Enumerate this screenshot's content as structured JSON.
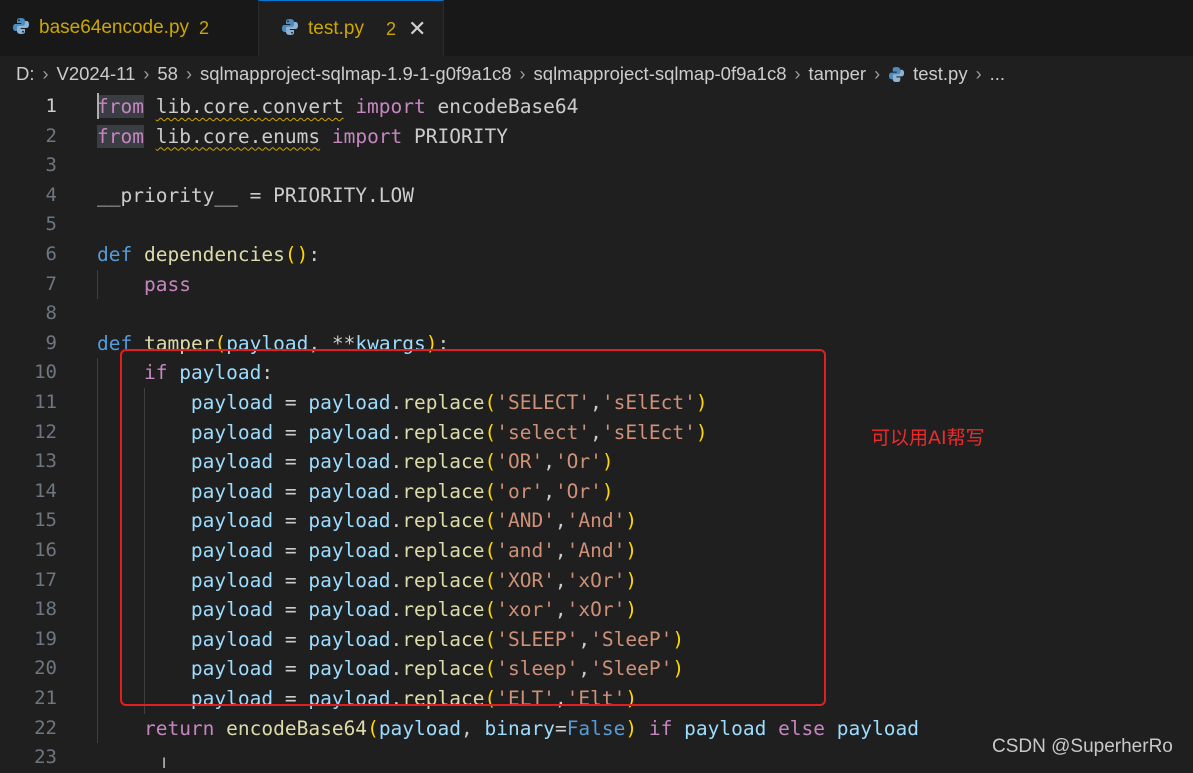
{
  "tabs": [
    {
      "name": "base64encode.py",
      "problems": "2",
      "icon": "python-icon"
    },
    {
      "name": "test.py",
      "problems": "2",
      "icon": "python-icon",
      "close": "✕"
    }
  ],
  "breadcrumb": {
    "items": [
      "D:",
      "V2024-11",
      "58",
      "sqlmapproject-sqlmap-1.9-1-g0f9a1c8",
      "sqlmapproject-sqlmap-0f9a1c8",
      "tamper"
    ],
    "file": "test.py",
    "more": "..."
  },
  "editor": {
    "active_line": 1,
    "lines": [
      "from lib.core.convert import encodeBase64",
      "from lib.core.enums import PRIORITY",
      "",
      "__priority__ = PRIORITY.LOW",
      "",
      "def dependencies():",
      "    pass",
      "",
      "def tamper(payload, **kwargs):",
      "    if payload:",
      "        payload = payload.replace('SELECT','sElEct')",
      "        payload = payload.replace('select','sElEct')",
      "        payload = payload.replace('OR','Or')",
      "        payload = payload.replace('or','Or')",
      "        payload = payload.replace('AND','And')",
      "        payload = payload.replace('and','And')",
      "        payload = payload.replace('XOR','xOr')",
      "        payload = payload.replace('xor','xOr')",
      "        payload = payload.replace('SLEEP','SleeP')",
      "        payload = payload.replace('sleep','SleeP')",
      "        payload = payload.replace('ELT','Elt')",
      "    return encodeBase64(payload, binary=False) if payload else payload",
      ""
    ]
  },
  "annotation": "可以用AI帮写",
  "watermark": "CSDN @SuperherRo",
  "colors": {
    "warning": "#cca700",
    "annotation_red": "#e02020",
    "keyword_blue": "#569cd6",
    "keyword_pink": "#c586c0",
    "string": "#ce9178",
    "function": "#dcdcaa",
    "variable": "#9cdcfe"
  }
}
